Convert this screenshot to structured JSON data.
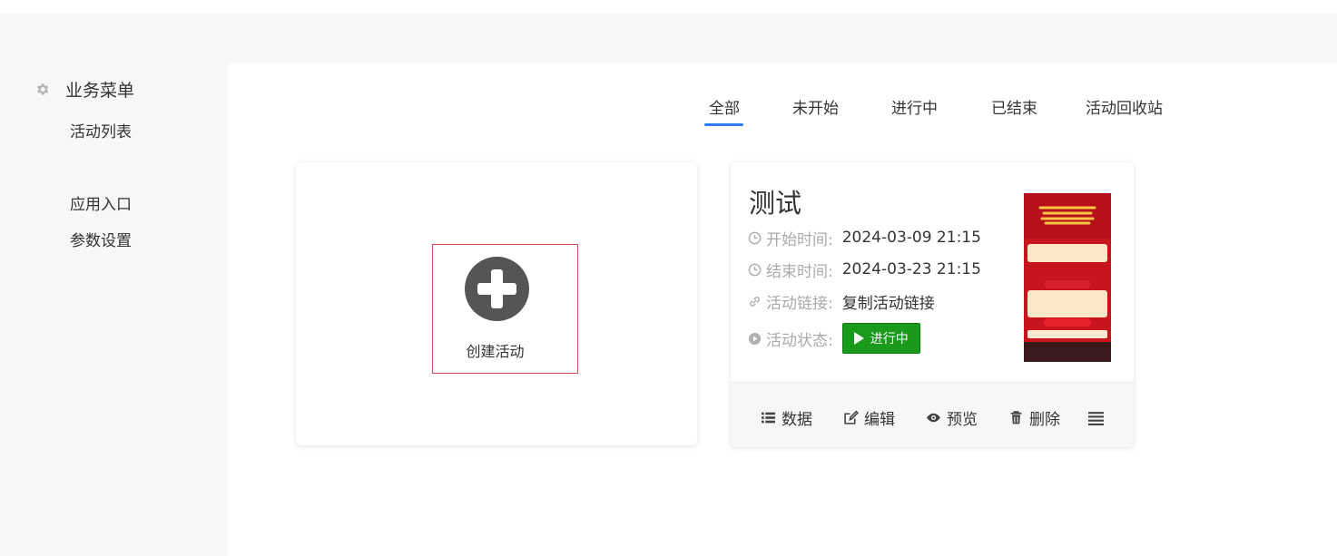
{
  "sidebar": {
    "title": "业务菜单",
    "items": [
      {
        "label": "活动列表"
      },
      {
        "label": "应用入口"
      },
      {
        "label": "参数设置"
      }
    ]
  },
  "tabs": [
    {
      "label": "全部",
      "active": true
    },
    {
      "label": "未开始"
    },
    {
      "label": "进行中"
    },
    {
      "label": "已结束"
    },
    {
      "label": "活动回收站"
    }
  ],
  "create_card": {
    "label": "创建活动"
  },
  "activity": {
    "title": "测试",
    "start_label": "开始时间:",
    "start_value": "2024-03-09 21:15",
    "end_label": "结束时间:",
    "end_value": "2024-03-23 21:15",
    "link_label": "活动链接:",
    "link_text": "复制活动链接",
    "status_label": "活动状态:",
    "status_value": "进行中"
  },
  "actions": {
    "data": "数据",
    "edit": "编辑",
    "preview": "预览",
    "delete": "删除"
  },
  "colors": {
    "accent": "#2f7cf6",
    "status_green": "#1a9a1a",
    "create_border": "#e0474c"
  }
}
